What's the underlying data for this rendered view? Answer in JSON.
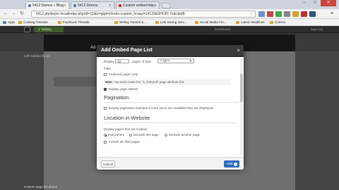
{
  "browser": {
    "tabs": [
      {
        "label": "5412 Demos » Blog"
      },
      {
        "label": "5412 Demos"
      },
      {
        "label": "Custom ombed http..."
      }
    ],
    "window_controls": [
      "–",
      "□",
      "✕"
    ],
    "address": "5412.pfeiferjon.local/index.php/dl=1|3&v=gtpt=chreko-custom_hrawy=1#133&SHODI 7e&c&sfE",
    "bookmarks": [
      "Apps",
      "Cooking Tutorials",
      "Facebook Threads",
      "Writing Tutorial &...",
      "Link Saving Serv...",
      "Social Media Fre...",
      "Latest Headlines",
      "Comics"
    ]
  },
  "page": {
    "edit_label": "✔ Editing",
    "dashboard_label": "Dashboard",
    "sign_out_label": "Sign Out",
    "left_heading": "Left Sidebar Blogs",
    "footer_text": "Custom page list above",
    "behind_title": "Ad"
  },
  "modal": {
    "title": "Add Ombed Page List",
    "close": "×",
    "display_label": "Display",
    "display_count": "10",
    "pages_of_type_label": "pages of type",
    "page_type_value": "** All **",
    "filter_label": "Filter",
    "featured_label": "Featured pages only.",
    "note_bold": "Note:",
    "note_text": "You must create the \"is_featured\" page attribute first.",
    "display_aliases_label": "Display page aliases.",
    "pagination_heading": "Pagination",
    "pagination_label": "Display pagination interface if more items are available than are displayed.",
    "location_heading": "Location in Website",
    "location_desc": "Display pages that are located:",
    "loc_everywhere": "everywhere",
    "loc_beneath_this": "beneath this page",
    "loc_beneath_another": "beneath another page",
    "include_child_label": "Include all child pages",
    "cancel_label": "Cancel",
    "add_label": "Add",
    "featured_checked": false,
    "aliases_checked": true,
    "pagination_checked": false,
    "location_selected": "everywhere",
    "include_child_checked": false
  },
  "colors": {
    "accent": "#2f6fc0",
    "close_button": "#c9463d"
  }
}
